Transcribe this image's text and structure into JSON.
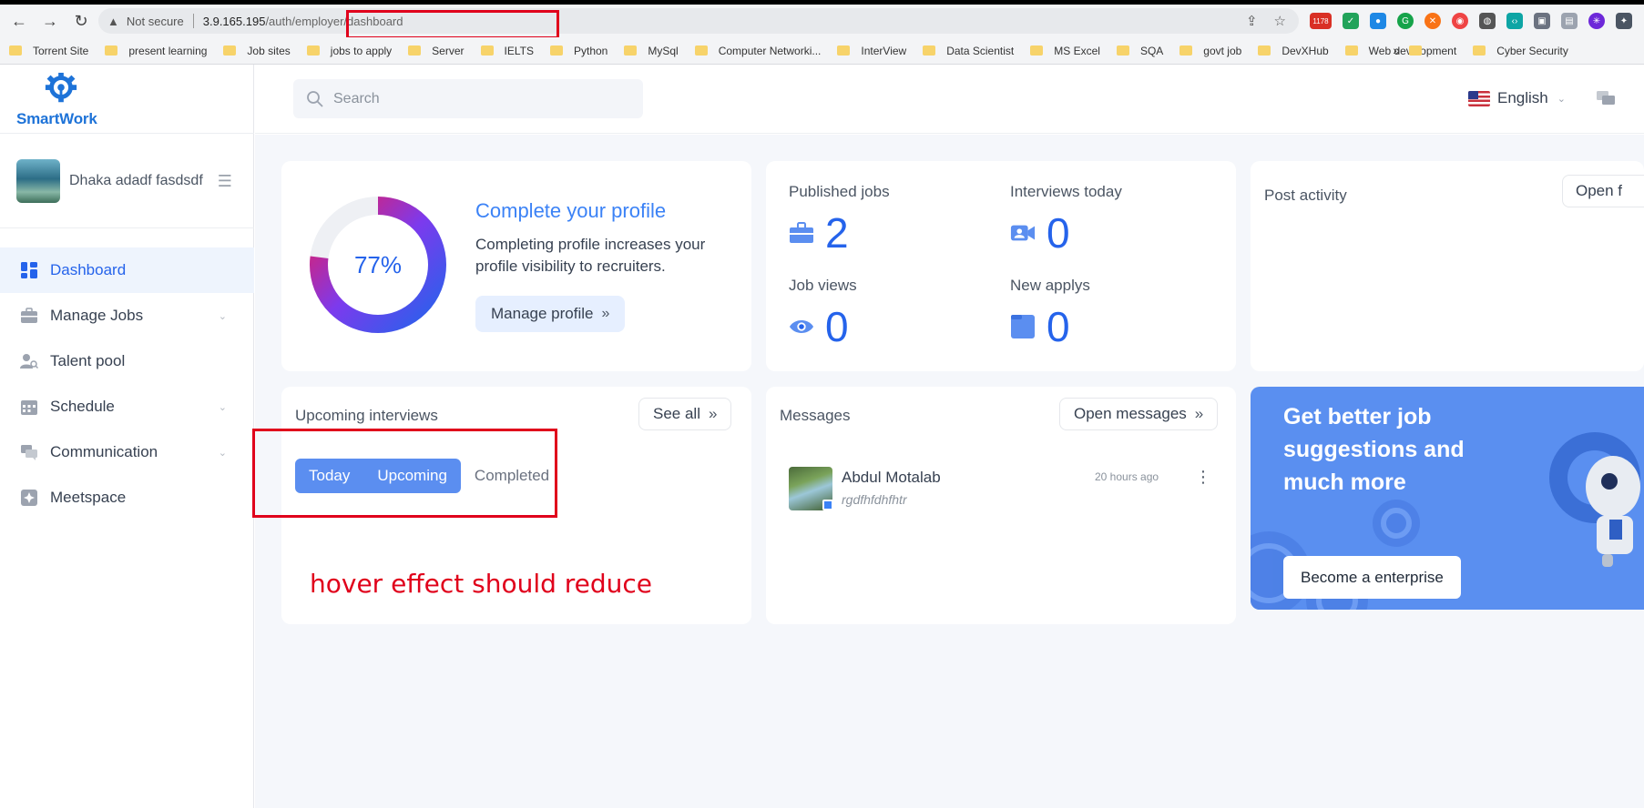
{
  "browser": {
    "security_label": "Not secure",
    "url_host": "3.9.165.195",
    "url_path": "/auth/employer/dashboard",
    "bookmarks": [
      "Torrent Site",
      "present learning",
      "Job sites",
      "jobs to apply",
      "Server",
      "IELTS",
      "Python",
      "MySql",
      "Computer Networki...",
      "InterView",
      "Data Scientist",
      "MS Excel",
      "SQA",
      "govt job",
      "DevXHub",
      "Web development",
      "Cyber Security"
    ],
    "ext_badge": "1178",
    "more_bookmarks": "»"
  },
  "sidebar": {
    "brand": "SmartWork",
    "user_name": "Dhaka adadf fasdsdf",
    "items": [
      {
        "label": "Dashboard"
      },
      {
        "label": "Manage Jobs"
      },
      {
        "label": "Talent pool"
      },
      {
        "label": "Schedule"
      },
      {
        "label": "Communication"
      },
      {
        "label": "Meetspace"
      }
    ]
  },
  "header": {
    "search_placeholder": "Search",
    "language": "English"
  },
  "profile_card": {
    "percent_label": "77%",
    "percent_value": 77,
    "title": "Complete your profile",
    "description": "Completing profile increases your profile visibility to recruiters.",
    "button": "Manage profile"
  },
  "stats": {
    "published_jobs": {
      "label": "Published jobs",
      "value": "2"
    },
    "interviews_today": {
      "label": "Interviews today",
      "value": "0"
    },
    "job_views": {
      "label": "Job views",
      "value": "0"
    },
    "new_applys": {
      "label": "New applys",
      "value": "0"
    }
  },
  "post_activity": {
    "title": "Post activity",
    "button": "Open f"
  },
  "interviews": {
    "title": "Upcoming interviews",
    "see_all": "See all",
    "tabs": [
      "Today",
      "Upcoming",
      "Completed"
    ],
    "annotation": "hover effect should reduce"
  },
  "messages": {
    "title": "Messages",
    "open_button": "Open messages",
    "items": [
      {
        "name": "Abdul Motalab",
        "preview": "rgdfhfdhfhtr",
        "time": "20 hours ago"
      }
    ]
  },
  "promo": {
    "title": "Get better job suggestions and much more",
    "button": "Become a enterprise"
  },
  "colors": {
    "accent": "#2563eb",
    "annotation": "#e0001b",
    "promo_bg": "#5a8ff0"
  }
}
